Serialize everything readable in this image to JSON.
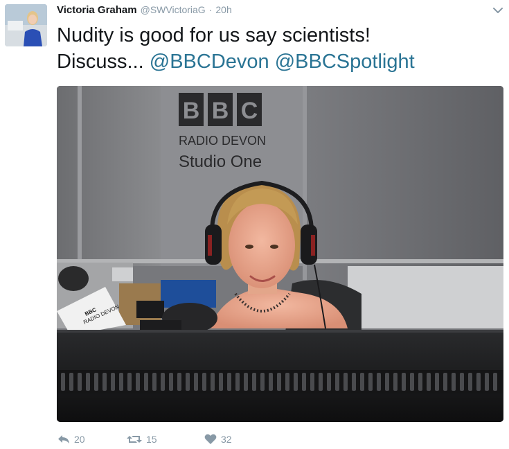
{
  "tweet": {
    "author_name": "Victoria Graham",
    "handle": "@SWVictoriaG",
    "separator": "·",
    "time": "20h",
    "text_line1": "Nudity is good for us say scientists!",
    "text_line2_prefix": "Discuss... ",
    "mention_1": "@BBCDevon",
    "mention_2": "@BBCSpotlight"
  },
  "media": {
    "sign": {
      "letters": [
        "B",
        "B",
        "C"
      ],
      "line1": "RADIO DEVON",
      "line2": "Studio One"
    },
    "desk_card_line1": "BBC",
    "desk_card_line2": "RADIO DEVON"
  },
  "actions": {
    "reply_count": "20",
    "retweet_count": "15",
    "like_count": "32"
  },
  "icons": {
    "avatar": "avatar",
    "caret": "chevron-down-icon",
    "reply": "reply-icon",
    "retweet": "retweet-icon",
    "like": "heart-icon"
  },
  "colors": {
    "mention": "#2a7494",
    "muted": "#8899a6",
    "text": "#14171a"
  }
}
